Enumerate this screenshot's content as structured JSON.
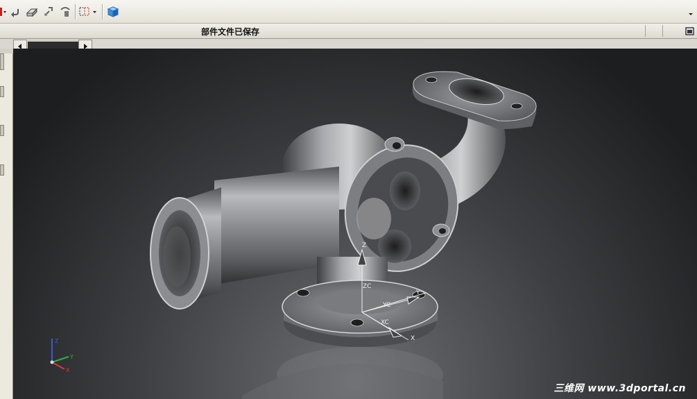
{
  "toolbar": {
    "buttons": [
      {
        "name": "undo-button",
        "icon": "undo-icon"
      },
      {
        "name": "part-navigator-button",
        "icon": "eraser-icon"
      },
      {
        "name": "transform-button",
        "icon": "move-icon"
      },
      {
        "name": "rotate-button",
        "icon": "rotate-icon"
      },
      {
        "name": "selection-box-button",
        "icon": "marquee-select-icon"
      },
      {
        "name": "view-cube-button",
        "icon": "cube-icon"
      }
    ]
  },
  "status": {
    "message": "部件文件已保存"
  },
  "viewport": {
    "axis_labels": {
      "z": "Z",
      "zc": "ZC",
      "yc": "YC",
      "xc": "XC",
      "y": "Y",
      "x": "X"
    },
    "triad_labels": {
      "z": "Z",
      "y": "Y",
      "x": "X"
    },
    "watermark": "三维网 www.3dportal.cn",
    "colors": {
      "background": "#2a2b2d",
      "part": "#8a8b8e"
    }
  }
}
